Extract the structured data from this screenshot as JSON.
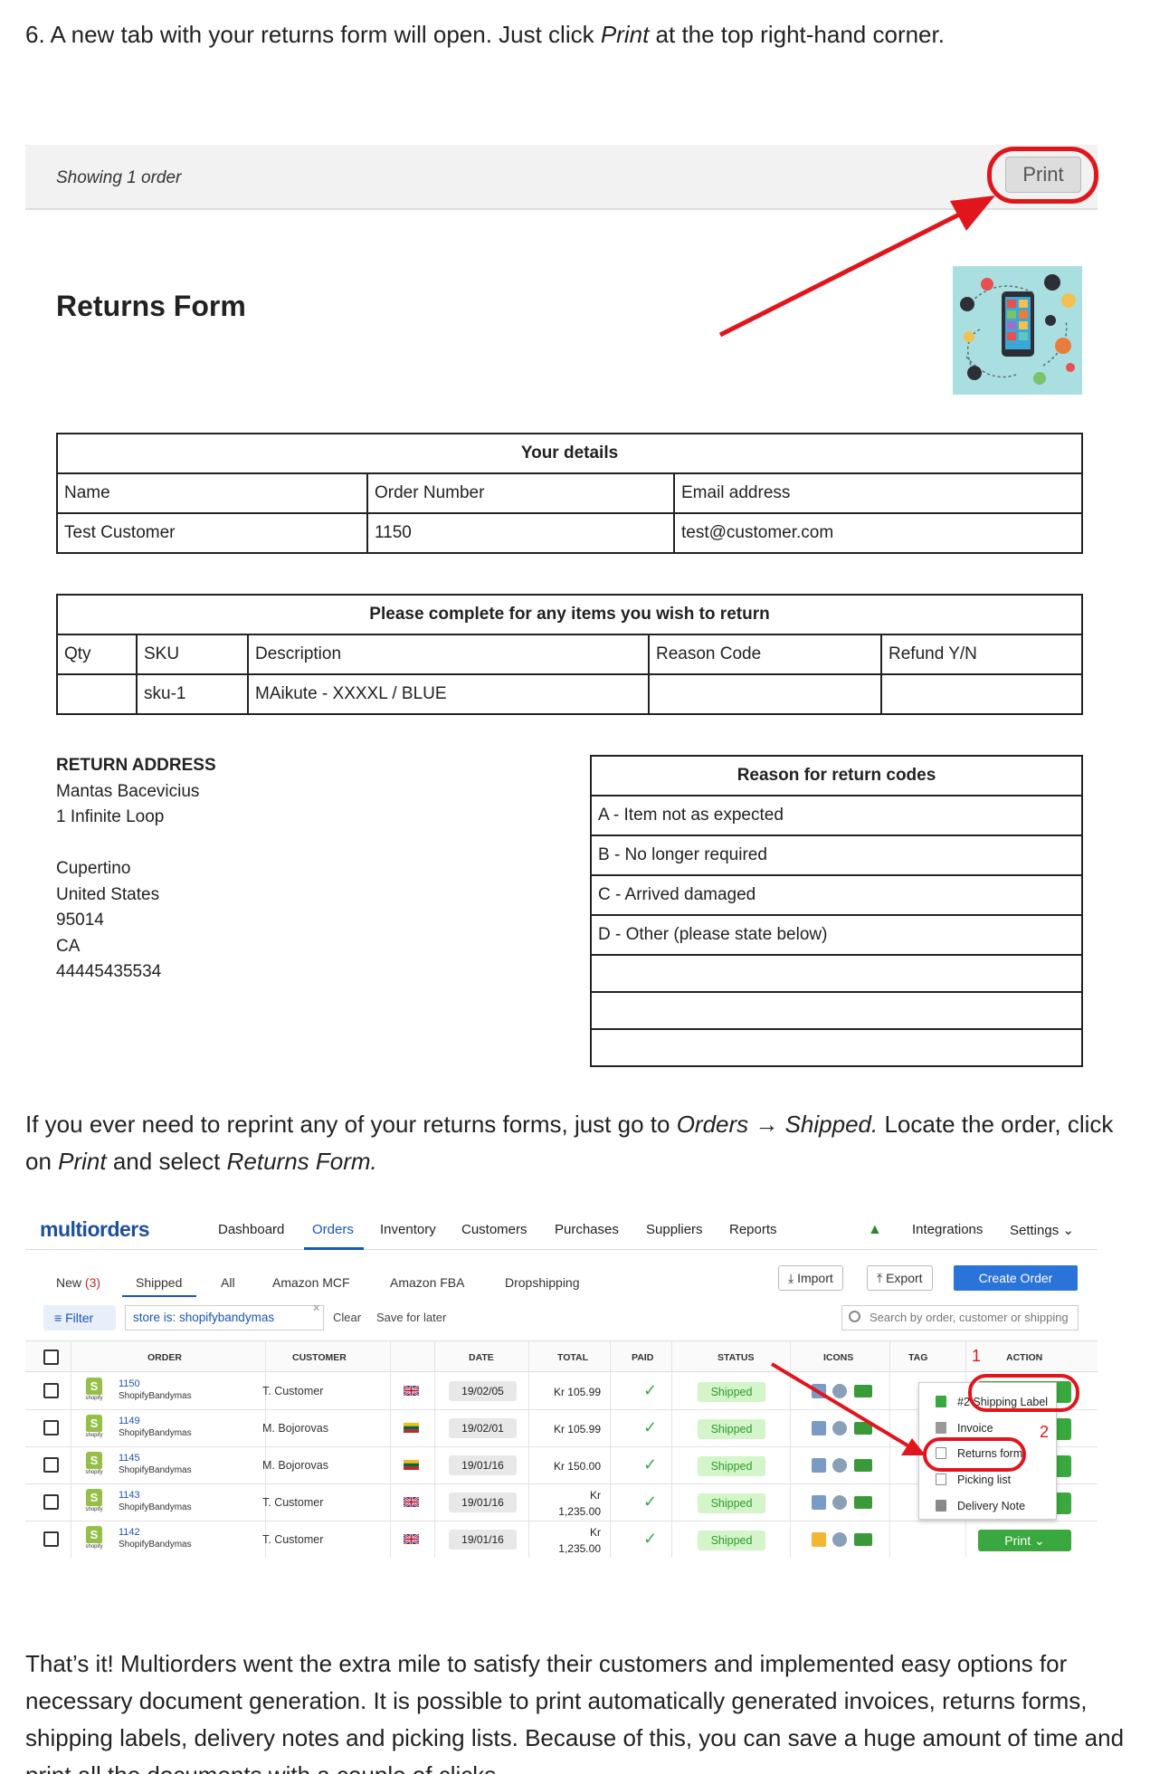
{
  "step_text": {
    "number": "6.",
    "part1": "A new tab with your returns form will open. Just click ",
    "em": "Print",
    "part2": " at the top right-hand corner."
  },
  "returns_page": {
    "showing": "Showing 1 order",
    "print_label": "Print",
    "title": "Returns Form",
    "details": {
      "heading": "Your details",
      "headers": [
        "Name",
        "Order Number",
        "Email address"
      ],
      "values": [
        "Test Customer",
        "1150",
        "test@customer.com"
      ]
    },
    "items": {
      "heading": "Please complete for any items you wish to return",
      "headers": [
        "Qty",
        "SKU",
        "Description",
        "Reason Code",
        "Refund Y/N"
      ],
      "row": [
        "",
        "sku-1",
        "MAikute - XXXXL / BLUE",
        "",
        ""
      ]
    },
    "address": {
      "title": "RETURN ADDRESS",
      "lines": [
        "Mantas Bacevicius",
        "1 Infinite Loop",
        "",
        "Cupertino",
        "United States",
        "95014",
        "CA",
        "44445435534"
      ]
    },
    "reasons": {
      "heading": "Reason for return codes",
      "codes": [
        "A - Item not as expected",
        "B - No longer required",
        "C - Arrived damaged",
        "D - Other (please state below)",
        "",
        "",
        ""
      ]
    }
  },
  "reprint_text": {
    "p1": "If you ever need to reprint any of your returns forms, just go to ",
    "em1": "Orders → Shipped.",
    "p2": " Locate the order, click on ",
    "em2": "Print",
    "p3": " and select ",
    "em3": "Returns Form."
  },
  "multiorders": {
    "logo": "multiorders",
    "nav": [
      "Dashboard",
      "Orders",
      "Inventory",
      "Customers",
      "Purchases",
      "Suppliers",
      "Reports"
    ],
    "nav_right": [
      "Integrations",
      "Settings ⌄"
    ],
    "subtabs": {
      "new": "New",
      "new_count": "(3)",
      "items": [
        "Shipped",
        "All",
        "Amazon MCF",
        "Amazon FBA",
        "Dropshipping"
      ]
    },
    "import_label": "Import",
    "export_label": "Export",
    "create_label": "Create Order",
    "filter_label": "Filter",
    "filter_chip": "store is: shopifybandymas",
    "clear_label": "Clear",
    "save_label": "Save for later",
    "search_placeholder": "Search by order, customer or shipping",
    "columns": [
      "ORDER",
      "CUSTOMER",
      "DATE",
      "TOTAL",
      "PAID",
      "STATUS",
      "ICONS",
      "TAG",
      "ACTION"
    ],
    "rows": [
      {
        "order": "1150",
        "store": "ShopifyBandymas",
        "customer": "T. Customer",
        "country": "uk",
        "date": "19/02/05",
        "total": "Kr 105.99",
        "status": "Shipped",
        "msg": "blue"
      },
      {
        "order": "1149",
        "store": "ShopifyBandymas",
        "customer": "M. Bojorovas",
        "country": "lt",
        "date": "19/02/01",
        "total": "Kr 105.99",
        "status": "Shipped",
        "msg": "blue"
      },
      {
        "order": "1145",
        "store": "ShopifyBandymas",
        "customer": "M. Bojorovas",
        "country": "lt",
        "date": "19/01/16",
        "total": "Kr 150.00",
        "status": "Shipped",
        "msg": "blue"
      },
      {
        "order": "1143",
        "store": "ShopifyBandymas",
        "customer": "T. Customer",
        "country": "uk",
        "date": "19/01/16",
        "total_l1": "Kr",
        "total_l2": "1,235.00",
        "status": "Shipped",
        "msg": "blue"
      },
      {
        "order": "1142",
        "store": "ShopifyBandymas",
        "customer": "T. Customer",
        "country": "uk",
        "date": "19/01/16",
        "total_l1": "Kr",
        "total_l2": "1,235.00",
        "status": "Shipped",
        "msg": "yellow"
      }
    ],
    "print_button": "Print ⌄",
    "print_menu": [
      "#2 Shipping Label",
      "Invoice",
      "Returns form",
      "Picking list",
      "Delivery Note"
    ],
    "annotations": [
      "1",
      "2"
    ],
    "shopify_small": "shopify",
    "colors": {
      "brand": "#1e4f9c",
      "print_green": "#39a83e",
      "highlight_red": "#e0161c"
    }
  },
  "closing_text": "That’s it! Multiorders went the extra mile to satisfy their customers and implemented easy options for necessary document generation. It is possible to print automatically generated invoices, returns forms, shipping labels, delivery notes and picking lists. Because of this, you can save a huge amount of time and print all the documents with a couple of clicks."
}
